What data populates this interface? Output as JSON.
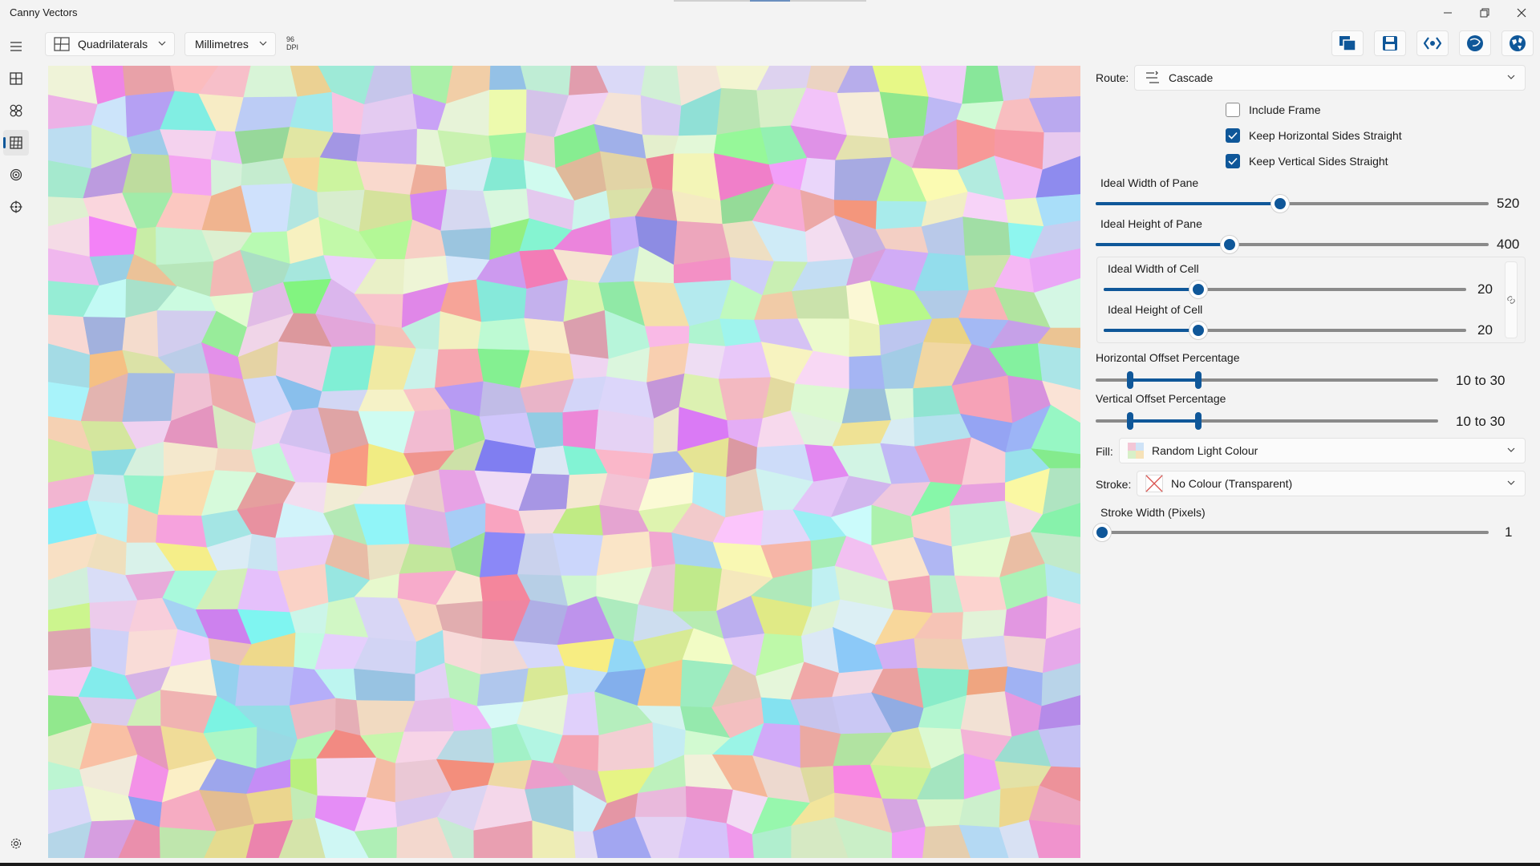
{
  "app": {
    "title": "Canny Vectors"
  },
  "toolbar": {
    "shape_select": "Quadrilaterals",
    "units_select": "Millimetres",
    "dpi_value": "96",
    "dpi_label": "DPI"
  },
  "nav": {
    "items": [
      "menu-icon",
      "grid-icon",
      "circles-icon",
      "quad-mesh-icon",
      "target-icon",
      "crosshair-icon"
    ],
    "selected": "quad-mesh-icon",
    "footer": "settings-icon"
  },
  "actions": [
    "copy-icon",
    "save-icon",
    "code-icon",
    "sphere-icon",
    "globe-icon"
  ],
  "panel": {
    "route_label": "Route:",
    "route_value": "Cascade",
    "include_frame": {
      "label": "Include Frame",
      "checked": false
    },
    "keep_horizontal": {
      "label": "Keep Horizontal Sides Straight",
      "checked": true
    },
    "keep_vertical": {
      "label": "Keep Vertical Sides Straight",
      "checked": true
    },
    "pane_width": {
      "label": "Ideal Width of Pane",
      "value": "520",
      "fraction": 0.47
    },
    "pane_height": {
      "label": "Ideal Height of Pane",
      "value": "400",
      "fraction": 0.34
    },
    "cell_width": {
      "label": "Ideal Width of Cell",
      "value": "20",
      "fraction": 0.26
    },
    "cell_height": {
      "label": "Ideal Height of Cell",
      "value": "20",
      "fraction": 0.26
    },
    "h_offset": {
      "label": "Horizontal Offset Percentage",
      "value": "10 to 30",
      "low": 10,
      "high": 30
    },
    "v_offset": {
      "label": "Vertical Offset Percentage",
      "value": "10 to 30",
      "low": 10,
      "high": 30
    },
    "fill_label": "Fill:",
    "fill_value": "Random Light Colour",
    "stroke_label": "Stroke:",
    "stroke_value": "No Colour (Transparent)",
    "stroke_width": {
      "label": "Stroke Width (Pixels)",
      "value": "1",
      "fraction": 0.0
    }
  },
  "colors": {
    "accent": "#0f5799",
    "window_bg": "#f3f3f3"
  }
}
